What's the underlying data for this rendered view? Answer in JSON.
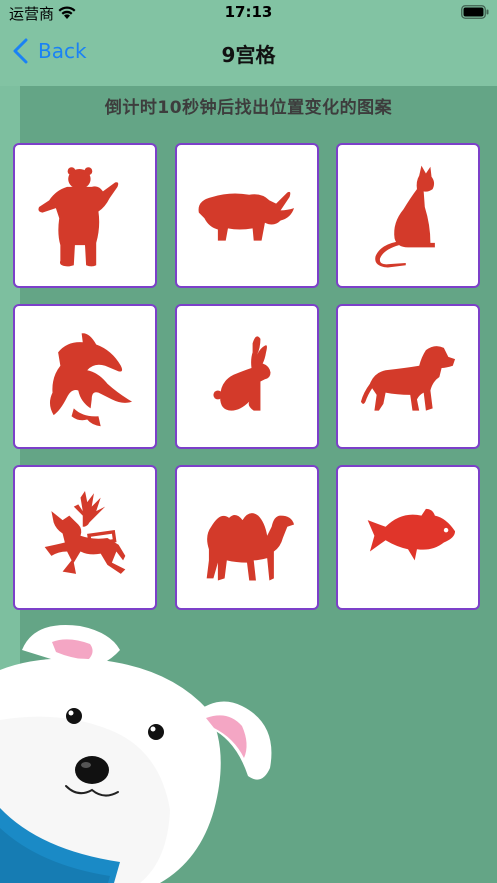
{
  "status_bar": {
    "carrier": "运营商",
    "time": "17:13"
  },
  "nav": {
    "back_label": "Back",
    "title": "9宫格"
  },
  "instruction": "倒计时10秒钟后找出位置变化的图案",
  "colors": {
    "accent": "#1a82f5",
    "cell_border": "#7c40c9",
    "animal_fill": "#d33a2a",
    "background_light": "#82c3a3",
    "background_dark": "#64a586"
  },
  "grid": {
    "cells": [
      {
        "animal": "bear-icon"
      },
      {
        "animal": "rhino-icon"
      },
      {
        "animal": "cat-icon"
      },
      {
        "animal": "dolphin-icon"
      },
      {
        "animal": "rabbit-icon"
      },
      {
        "animal": "dog-icon"
      },
      {
        "animal": "reindeer-icon"
      },
      {
        "animal": "camel-icon"
      },
      {
        "animal": "fish-icon"
      }
    ]
  }
}
